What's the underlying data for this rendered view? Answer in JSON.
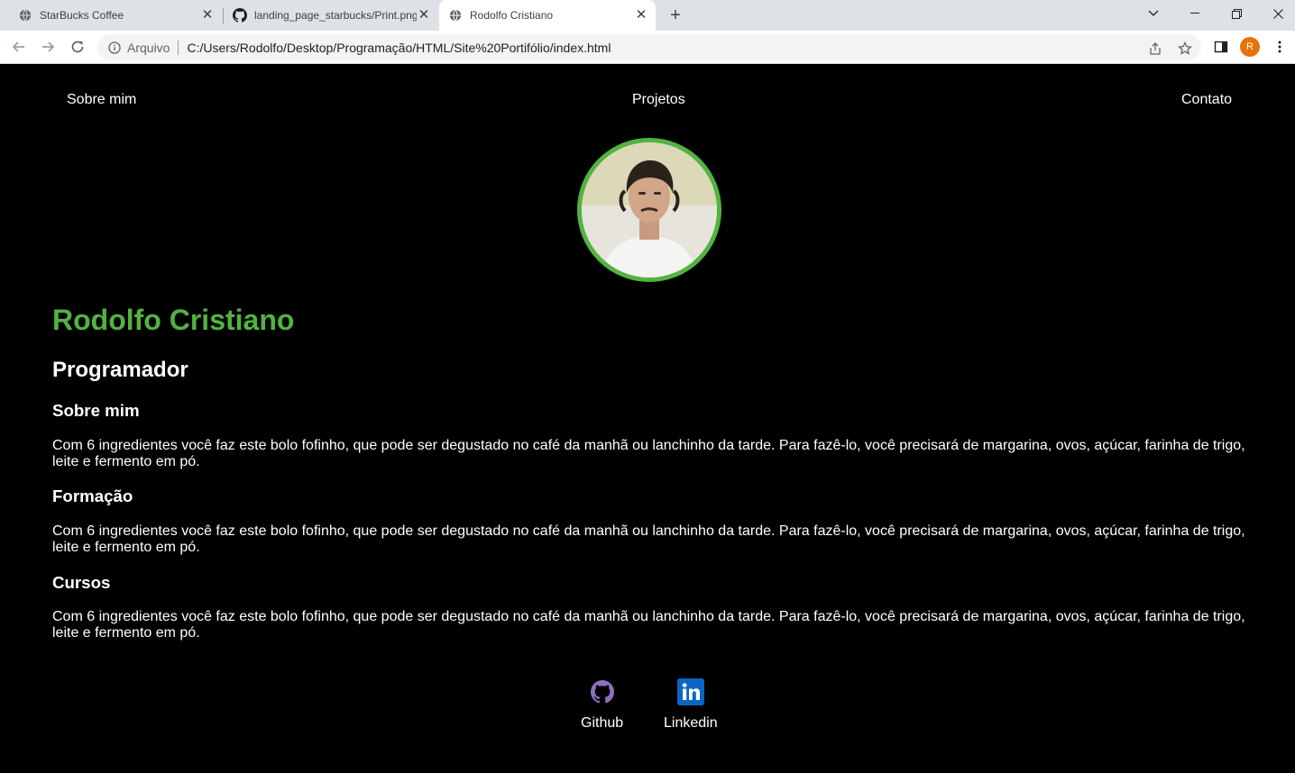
{
  "browser": {
    "tabs": [
      {
        "title": "StarBucks Coffee",
        "icon": "globe-icon"
      },
      {
        "title": "landing_page_starbucks/Print.png",
        "icon": "github-icon"
      },
      {
        "title": "Rodolfo Cristiano",
        "icon": "globe-icon",
        "active": true
      }
    ],
    "address": {
      "scheme": "Arquivo",
      "url": "C:/Users/Rodolfo/Desktop/Programação/HTML/Site%20Portifólio/index.html"
    },
    "profile_initial": "R"
  },
  "page": {
    "nav": {
      "about": "Sobre mim",
      "projects": "Projetos",
      "contact": "Contato"
    },
    "name": "Rodolfo Cristiano",
    "role": "Programador",
    "sections": [
      {
        "title": "Sobre mim",
        "text": "Com 6 ingredientes você faz este bolo fofinho, que pode ser degustado no café da manhã ou lanchinho da tarde. Para fazê-lo, você precisará de margarina, ovos, açúcar, farinha de trigo, leite e fermento em pó."
      },
      {
        "title": "Formação",
        "text": "Com 6 ingredientes você faz este bolo fofinho, que pode ser degustado no café da manhã ou lanchinho da tarde. Para fazê-lo, você precisará de margarina, ovos, açúcar, farinha de trigo, leite e fermento em pó."
      },
      {
        "title": "Cursos",
        "text": "Com 6 ingredientes você faz este bolo fofinho, que pode ser degustado no café da manhã ou lanchinho da tarde. Para fazê-lo, você precisará de margarina, ovos, açúcar, farinha de trigo, leite e fermento em pó."
      }
    ],
    "social": [
      {
        "label": "Github",
        "icon": "github-icon"
      },
      {
        "label": "Linkedin",
        "icon": "linkedin-icon"
      }
    ],
    "colors": {
      "accent": "#52b340",
      "background": "#000000",
      "text": "#ffffff",
      "github_icon": "#8e6fbf",
      "linkedin": "#0a66c2"
    }
  }
}
